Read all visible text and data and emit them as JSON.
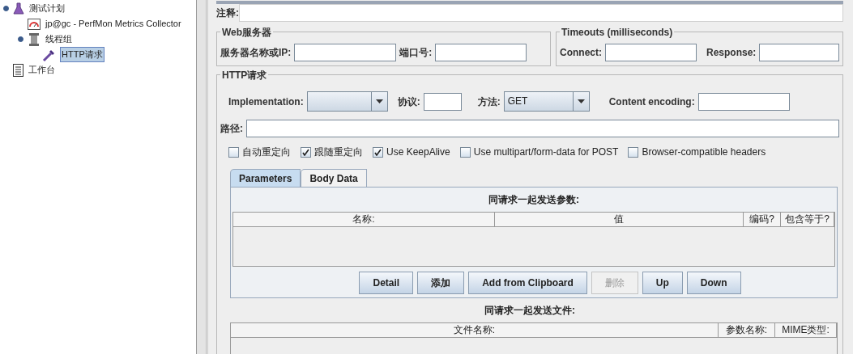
{
  "tree": [
    {
      "label": "测试计划",
      "kind": "plan",
      "expanded": true,
      "selected": false,
      "children": [
        {
          "label": "jp@gc - PerfMon Metrics Collector",
          "kind": "monitor",
          "selected": false
        },
        {
          "label": "线程组",
          "kind": "threads",
          "expanded": true,
          "selected": false,
          "children": [
            {
              "label": "HTTP请求",
              "kind": "sampler",
              "selected": true
            }
          ]
        }
      ]
    },
    {
      "label": "工作台",
      "kind": "workbench",
      "selected": false
    }
  ],
  "comment": {
    "label": "注释:"
  },
  "web_server": {
    "title": "Web服务器",
    "server_label": "服务器名称或IP:",
    "port_label": "端口号:"
  },
  "timeouts": {
    "title": "Timeouts (milliseconds)",
    "connect_label": "Connect:",
    "response_label": "Response:"
  },
  "http_request": {
    "title": "HTTP请求",
    "implementation_label": "Implementation:",
    "protocol_label": "协议:",
    "method_label": "方法:",
    "method_value": "GET",
    "encoding_label": "Content encoding:",
    "path_label": "路径:",
    "options": [
      {
        "label": "自动重定向",
        "checked": false
      },
      {
        "label": "跟随重定向",
        "checked": true
      },
      {
        "label": "Use KeepAlive",
        "checked": true
      },
      {
        "label": "Use multipart/form-data for POST",
        "checked": false
      },
      {
        "label": "Browser-compatible headers",
        "checked": false
      }
    ]
  },
  "tabs": [
    {
      "label": "Parameters",
      "selected": true
    },
    {
      "label": "Body Data",
      "selected": false
    }
  ],
  "parameters": {
    "title": "同请求一起发送参数:",
    "columns": [
      "名称:",
      "值",
      "编码?",
      "包含等于?"
    ]
  },
  "buttons": [
    {
      "label": "Detail",
      "disabled": false
    },
    {
      "label": "添加",
      "disabled": false
    },
    {
      "label": "Add from Clipboard",
      "disabled": false
    },
    {
      "label": "删除",
      "disabled": true
    },
    {
      "label": "Up",
      "disabled": false
    },
    {
      "label": "Down",
      "disabled": false
    }
  ],
  "files": {
    "title": "同请求一起发送文件:",
    "columns": [
      "文件名称:",
      "参数名称:",
      "MIME类型:"
    ]
  }
}
